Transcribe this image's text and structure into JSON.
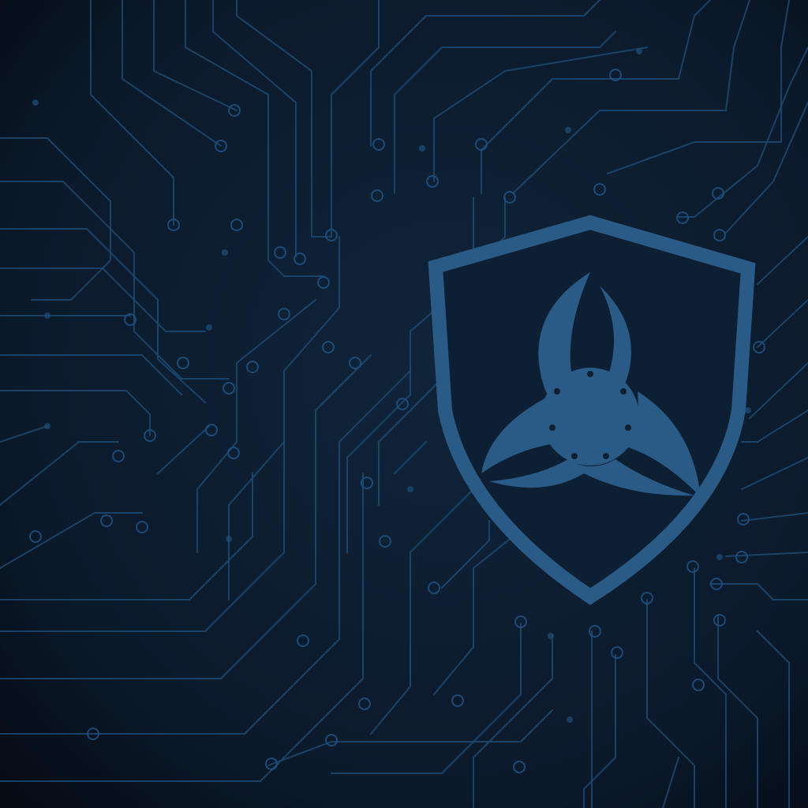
{
  "scene": {
    "background_color": "#0b1a2b",
    "vignette_color": "#050c16",
    "trace_color": "#1d4a72",
    "emblem_color": "#2a5a86",
    "emblem_icon": "shield-biohazard-icon",
    "circuit_icon": "circuit-board-traces"
  }
}
